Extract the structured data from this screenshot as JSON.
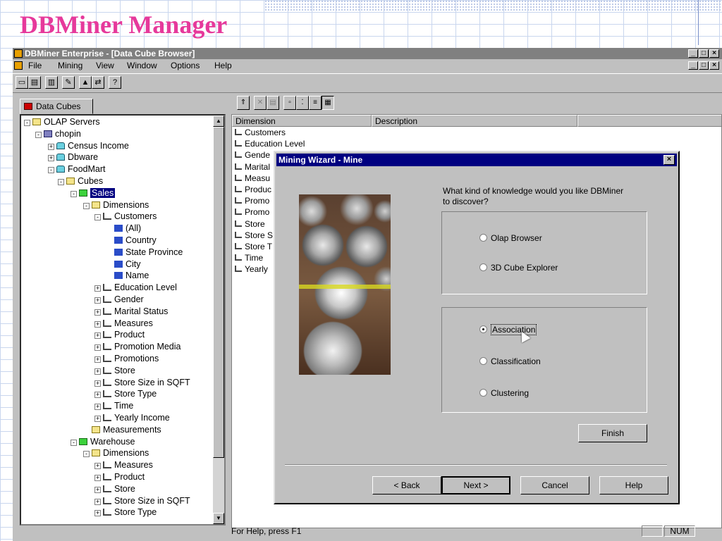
{
  "slide": {
    "title": "DBMiner Manager"
  },
  "window": {
    "title": "DBMiner Enterprise - [Data Cube Browser]",
    "controls": [
      "_",
      "□",
      "×"
    ],
    "menu": [
      "File",
      "Mining",
      "View",
      "Window",
      "Options",
      "Help"
    ]
  },
  "toolbar": {
    "buttons": [
      "save-icon",
      "print-icon",
      "properties-icon",
      "wizard-icon",
      "chart-icon",
      "mine-icon",
      "help-icon"
    ],
    "help_label": "?"
  },
  "left_panel": {
    "tab_label": "Data Cubes",
    "tree": [
      {
        "label": "OLAP Servers",
        "icon": "folder-icon",
        "expander": "-"
      },
      {
        "label": "chopin",
        "icon": "server-icon",
        "expander": "-"
      },
      {
        "label": "Census Income",
        "icon": "database-icon",
        "expander": "+"
      },
      {
        "label": "Dbware",
        "icon": "database-icon",
        "expander": "+"
      },
      {
        "label": "FoodMart",
        "icon": "database-icon",
        "expander": "-"
      },
      {
        "label": "Cubes",
        "icon": "folder-icon",
        "expander": "-"
      },
      {
        "label": "Sales",
        "icon": "cube-icon",
        "expander": "-",
        "selected": true
      },
      {
        "label": "Dimensions",
        "icon": "folder-open-icon",
        "expander": "-"
      },
      {
        "label": "Customers",
        "icon": "dimension-icon",
        "expander": "-"
      },
      {
        "label": "(All)",
        "icon": "level-icon",
        "expander": ""
      },
      {
        "label": "Country",
        "icon": "level-icon",
        "expander": ""
      },
      {
        "label": "State Province",
        "icon": "level-icon",
        "expander": ""
      },
      {
        "label": "City",
        "icon": "level-icon",
        "expander": ""
      },
      {
        "label": "Name",
        "icon": "level-icon",
        "expander": ""
      },
      {
        "label": "Education Level",
        "icon": "dimension-icon",
        "expander": "+"
      },
      {
        "label": "Gender",
        "icon": "dimension-icon",
        "expander": "+"
      },
      {
        "label": "Marital Status",
        "icon": "dimension-icon",
        "expander": "+"
      },
      {
        "label": "Measures",
        "icon": "dimension-icon",
        "expander": "+"
      },
      {
        "label": "Product",
        "icon": "dimension-icon",
        "expander": "+"
      },
      {
        "label": "Promotion Media",
        "icon": "dimension-icon",
        "expander": "+"
      },
      {
        "label": "Promotions",
        "icon": "dimension-icon",
        "expander": "+"
      },
      {
        "label": "Store",
        "icon": "dimension-icon",
        "expander": "+"
      },
      {
        "label": "Store Size in SQFT",
        "icon": "dimension-icon",
        "expander": "+"
      },
      {
        "label": "Store Type",
        "icon": "dimension-icon",
        "expander": "+"
      },
      {
        "label": "Time",
        "icon": "dimension-icon",
        "expander": "+"
      },
      {
        "label": "Yearly Income",
        "icon": "dimension-icon",
        "expander": "+"
      },
      {
        "label": "Measurements",
        "icon": "folder-icon",
        "expander": ""
      },
      {
        "label": "Warehouse",
        "icon": "cube-icon",
        "expander": "-"
      },
      {
        "label": "Dimensions",
        "icon": "folder-icon",
        "expander": "-"
      },
      {
        "label": "Measures",
        "icon": "dimension-icon",
        "expander": "+"
      },
      {
        "label": "Product",
        "icon": "dimension-icon",
        "expander": "+"
      },
      {
        "label": "Store",
        "icon": "dimension-icon",
        "expander": "+"
      },
      {
        "label": "Store Size in SQFT",
        "icon": "dimension-icon",
        "expander": "+"
      },
      {
        "label": "Store Type",
        "icon": "dimension-icon",
        "expander": "+"
      }
    ]
  },
  "right_panel": {
    "columns": [
      "Dimension",
      "Description"
    ],
    "rows": [
      "Customers",
      "Education Level",
      "Gende",
      "Marital",
      "Measu",
      "Produc",
      "Promo",
      "Promo",
      "Store",
      "Store S",
      "Store T",
      "Time",
      "Yearly"
    ]
  },
  "status": {
    "help_text": "For Help, press F1",
    "num": "NUM"
  },
  "dialog": {
    "title": "Mining Wizard - Mine",
    "close": "×",
    "question": "What kind of knowledge would you like DBMiner to discover?",
    "group1": [
      {
        "label": "Olap Browser",
        "checked": false
      },
      {
        "label": "3D Cube Explorer",
        "checked": false
      }
    ],
    "group2": [
      {
        "label": "Association",
        "checked": true
      },
      {
        "label": "Classification",
        "checked": false
      },
      {
        "label": "Clustering",
        "checked": false
      }
    ],
    "finish": "Finish",
    "back": "< Back",
    "next": "Next >",
    "cancel": "Cancel",
    "help": "Help"
  }
}
